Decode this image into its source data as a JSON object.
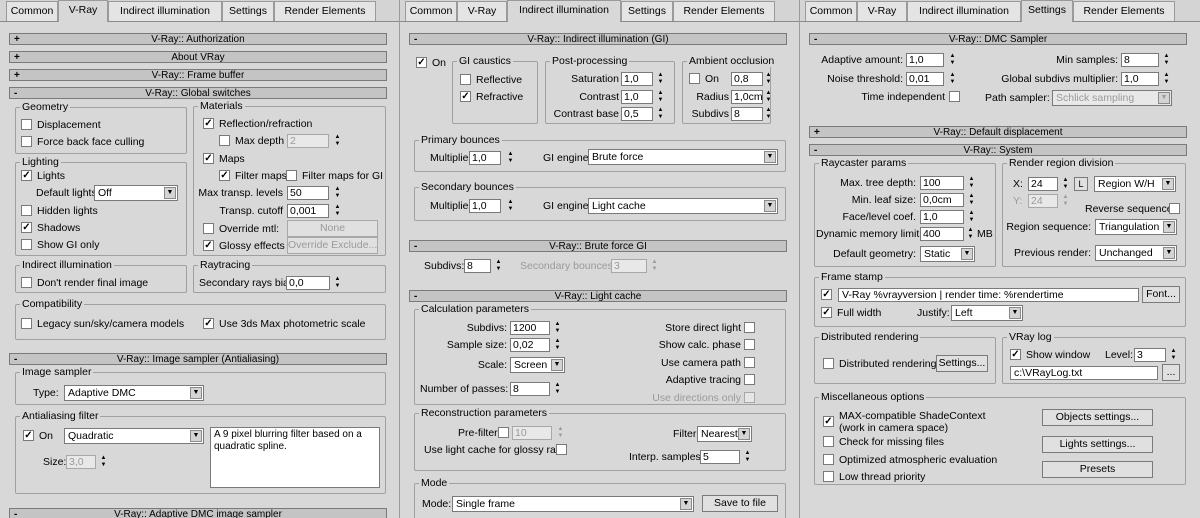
{
  "tabs": {
    "common": "Common",
    "vray": "V-Ray",
    "gi": "Indirect illumination",
    "settings": "Settings",
    "render_elements": "Render Elements"
  },
  "p1": {
    "authorization": "V-Ray:: Authorization",
    "about": "About VRay",
    "frame_buffer": "V-Ray:: Frame buffer",
    "global_switches": "V-Ray:: Global switches",
    "geometry": "Geometry",
    "displacement": "Displacement",
    "force_back": "Force back face culling",
    "lighting": "Lighting",
    "lights": "Lights",
    "default_lights": "Default lights",
    "default_lights_value": "Off",
    "hidden_lights": "Hidden lights",
    "shadows": "Shadows",
    "show_gi_only": "Show GI only",
    "indirect": "Indirect illumination",
    "dont_render": "Don't render final image",
    "materials": "Materials",
    "reflection": "Reflection/refraction",
    "max_depth": "Max depth",
    "max_depth_value": "2",
    "maps": "Maps",
    "filter_maps": "Filter maps",
    "filter_maps_gi": "Filter maps for GI",
    "max_transp": "Max transp. levels",
    "max_transp_value": "50",
    "transp_cutoff": "Transp. cutoff",
    "transp_cutoff_value": "0,001",
    "override_mtl": "Override mtl:",
    "none": "None",
    "glossy": "Glossy effects",
    "override_exclude": "Override Exclude...",
    "raytracing": "Raytracing",
    "secondary_bias": "Secondary rays bias",
    "secondary_bias_value": "0,0",
    "compatibility": "Compatibility",
    "legacy": "Legacy sun/sky/camera models",
    "photometric": "Use 3ds Max photometric scale",
    "image_sampler_rollout": "V-Ray:: Image sampler (Antialiasing)",
    "image_sampler": "Image sampler",
    "type": "Type:",
    "type_value": "Adaptive DMC",
    "aa_filter": "Antialiasing filter",
    "on": "On",
    "filter_value": "Quadratic",
    "filter_desc": "A 9 pixel blurring filter based on a quadratic spline.",
    "size": "Size:",
    "size_value": "3,0",
    "adaptive_dmc": "V-Ray:: Adaptive DMC image sampler"
  },
  "p2": {
    "gi_rollout": "V-Ray:: Indirect illumination (GI)",
    "on": "On",
    "gi_caustics": "GI caustics",
    "reflective": "Reflective",
    "refractive": "Refractive",
    "post": "Post-processing",
    "saturation": "Saturation",
    "saturation_value": "1,0",
    "contrast": "Contrast",
    "contrast_value": "1,0",
    "contrast_base": "Contrast base",
    "contrast_base_value": "0,5",
    "ao": "Ambient occlusion",
    "ao_on": "On",
    "ao_value": "0,8",
    "radius": "Radius",
    "radius_value": "1,0cm",
    "subdivs": "Subdivs",
    "subdivs_value": "8",
    "primary": "Primary bounces",
    "multiplier": "Multiplier",
    "mult1_value": "1,0",
    "gi_engine": "GI engine",
    "primary_engine": "Brute force",
    "secondary": "Secondary bounces",
    "mult2_value": "1,0",
    "secondary_engine": "Light cache",
    "bf_rollout": "V-Ray:: Brute force GI",
    "bf_subdivs": "Subdivs:",
    "bf_subdivs_value": "8",
    "bf_secondary": "Secondary bounces:",
    "bf_secondary_value": "3",
    "lc_rollout": "V-Ray:: Light cache",
    "calc": "Calculation parameters",
    "lc_subdivs": "Subdivs:",
    "lc_subdivs_value": "1200",
    "sample_size": "Sample size:",
    "sample_size_value": "0,02",
    "scale": "Scale:",
    "scale_value": "Screen",
    "passes": "Number of passes:",
    "passes_value": "8",
    "store_direct": "Store direct light",
    "show_calc": "Show calc. phase",
    "use_camera": "Use camera path",
    "adaptive_tracing": "Adaptive tracing",
    "use_directions": "Use directions only",
    "recon": "Reconstruction parameters",
    "prefilter": "Pre-filter:",
    "prefilter_value": "10",
    "filter": "Filter:",
    "filter_value": "Nearest",
    "use_lc_glossy": "Use light cache for glossy rays",
    "interp": "Interp. samples:",
    "interp_value": "5",
    "mode_group": "Mode",
    "mode": "Mode:",
    "mode_value": "Single frame",
    "save": "Save to file"
  },
  "p3": {
    "dmc_rollout": "V-Ray:: DMC Sampler",
    "adaptive_amount": "Adaptive amount:",
    "adaptive_amount_value": "1,0",
    "noise": "Noise threshold:",
    "noise_value": "0,01",
    "time_indep": "Time independent",
    "min_samples": "Min samples:",
    "min_samples_value": "8",
    "global_subdivs": "Global subdivs multiplier:",
    "global_subdivs_value": "1,0",
    "path_sampler": "Path sampler:",
    "path_sampler_value": "Schlick sampling",
    "default_disp": "V-Ray:: Default displacement",
    "system": "V-Ray:: System",
    "raycaster": "Raycaster params",
    "max_tree": "Max. tree depth:",
    "max_tree_value": "100",
    "min_leaf": "Min. leaf size:",
    "min_leaf_value": "0,0cm",
    "face_level": "Face/level coef.",
    "face_level_value": "1,0",
    "dyn_mem": "Dynamic memory limit:",
    "dyn_mem_value": "400",
    "mb": "MB",
    "default_geom": "Default geometry:",
    "default_geom_value": "Static",
    "region_div": "Render region division",
    "x": "X:",
    "x_value": "24",
    "y": "Y:",
    "y_value": "24",
    "l": "L",
    "region_type": "Region W/H",
    "reverse": "Reverse sequence",
    "region_seq": "Region sequence:",
    "region_seq_value": "Triangulation",
    "prev_render": "Previous render:",
    "prev_render_value": "Unchanged",
    "frame_stamp": "Frame stamp",
    "stamp_value": "V-Ray %vrayversion | render time: %rendertime",
    "font": "Font...",
    "full_width": "Full width",
    "justify": "Justify:",
    "justify_value": "Left",
    "distributed": "Distributed rendering",
    "dist_check": "Distributed rendering",
    "dist_settings": "Settings...",
    "vray_log": "VRay log",
    "show_window": "Show window",
    "level": "Level:",
    "level_value": "3",
    "log_path": "c:\\VRayLog.txt",
    "browse": "...",
    "misc": "Miscellaneous options",
    "max_compat": "MAX-compatible ShadeContext",
    "max_compat2": "(work in camera space)",
    "check_missing": "Check for missing files",
    "optimized": "Optimized atmospheric evaluation",
    "low_thread": "Low thread priority",
    "objects_settings": "Objects settings...",
    "lights_settings": "Lights settings...",
    "presets": "Presets"
  },
  "icons": {
    "check": "checkmark-icon",
    "spinner": "spinner-arrows-icon",
    "dropdown": "chevron-down-icon"
  }
}
